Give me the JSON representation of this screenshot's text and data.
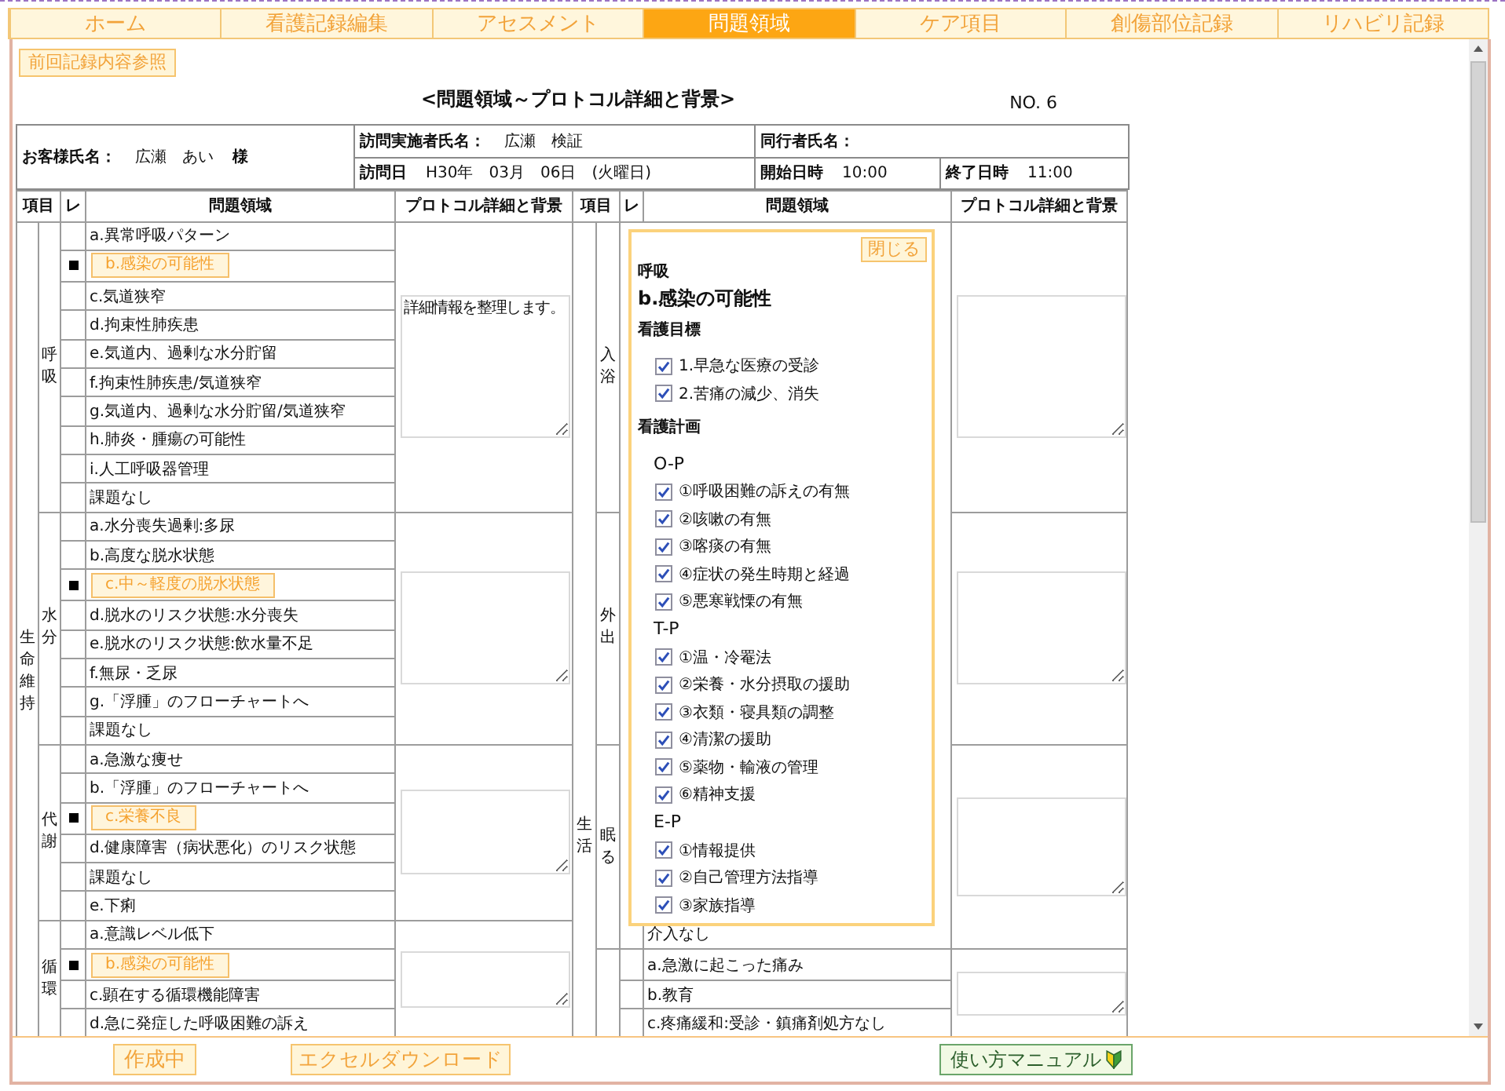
{
  "tabs": [
    {
      "label": "ホーム",
      "selected": false
    },
    {
      "label": "看護記録編集",
      "selected": false
    },
    {
      "label": "アセスメント",
      "selected": false
    },
    {
      "label": "問題領域",
      "selected": true
    },
    {
      "label": "ケア項目",
      "selected": false
    },
    {
      "label": "創傷部位記録",
      "selected": false
    },
    {
      "label": "リハビリ記録",
      "selected": false
    }
  ],
  "previous_record_button": "前回記録内容参照",
  "title": "<問題領域～プロトコル詳細と背景>",
  "record_number": "NO. 6",
  "visit_info": {
    "customer": {
      "label": "お客様氏名：",
      "value": "広瀬　あい",
      "suffix": "様"
    },
    "visitor": {
      "label": "訪問実施者氏名：",
      "value": "広瀬　検証"
    },
    "companion": {
      "label": "同行者氏名："
    },
    "visit_date": {
      "label": "訪問日",
      "value": "H30年　03月　06日　(火曜日)"
    },
    "start_time": {
      "label": "開始日時",
      "value": "10:00"
    },
    "end_time": {
      "label": "終了日時",
      "value": "11:00"
    }
  },
  "table": {
    "left": {
      "columns": [
        "項目",
        "レ",
        "問題領域",
        "プロトコル詳細と背景"
      ],
      "category": "生命維持",
      "groups": [
        {
          "label": "呼吸",
          "protocol": "詳細情報を整理します。",
          "rows": [
            {
              "text": "a.異常呼吸パターン",
              "checked": false
            },
            {
              "text": "b.感染の可能性",
              "checked": true
            },
            {
              "text": "c.気道狭窄",
              "checked": false
            },
            {
              "text": "d.拘束性肺疾患",
              "checked": false
            },
            {
              "text": "e.気道内、過剰な水分貯留",
              "checked": false
            },
            {
              "text": "f.拘束性肺疾患/気道狭窄",
              "checked": false
            },
            {
              "text": "g.気道内、過剰な水分貯留/気道狭窄",
              "checked": false
            },
            {
              "text": "h.肺炎・腫瘍の可能性",
              "checked": false
            },
            {
              "text": "i.人工呼吸器管理",
              "checked": false
            },
            {
              "text": "課題なし",
              "checked": false
            }
          ]
        },
        {
          "label": "水分",
          "rows": [
            {
              "text": "a.水分喪失過剰:多尿",
              "checked": false
            },
            {
              "text": "b.高度な脱水状態",
              "checked": false
            },
            {
              "text": "c.中～軽度の脱水状態",
              "checked": true
            },
            {
              "text": "d.脱水のリスク状態:水分喪失",
              "checked": false
            },
            {
              "text": "e.脱水のリスク状態:飲水量不足",
              "checked": false
            },
            {
              "text": "f.無尿・乏尿",
              "checked": false
            },
            {
              "text": "g.「浮腫」のフローチャートへ",
              "checked": false
            },
            {
              "text": "課題なし",
              "checked": false
            }
          ]
        },
        {
          "label": "代謝",
          "rows": [
            {
              "text": "a.急激な痩せ",
              "checked": false
            },
            {
              "text": "b.「浮腫」のフローチャートへ",
              "checked": false
            },
            {
              "text": "c.栄養不良",
              "checked": true
            },
            {
              "text": "d.健康障害（病状悪化）のリスク状態",
              "checked": false
            },
            {
              "text": "課題なし",
              "checked": false
            },
            {
              "text": "e.下痢",
              "checked": false
            }
          ]
        },
        {
          "label": "循環",
          "rows": [
            {
              "text": "a.意識レベル低下",
              "checked": false
            },
            {
              "text": "b.感染の可能性",
              "checked": true
            },
            {
              "text": "c.顕在する循環機能障害",
              "checked": false
            },
            {
              "text": "d.急に発症した呼吸困難の訴え",
              "checked": false
            }
          ]
        }
      ]
    },
    "right": {
      "columns": [
        "項目",
        "レ",
        "問題領域",
        "プロトコル詳細と背景"
      ],
      "category": "生活",
      "groups": [
        {
          "label": "入浴"
        },
        {
          "label": "外出"
        },
        {
          "label": "眠る",
          "rows": [
            {
              "text": "介入なし",
              "checked": false
            }
          ]
        },
        {
          "rows": [
            {
              "text": "a.急激に起こった痛み",
              "checked": false
            },
            {
              "text": "b.教育",
              "checked": false
            },
            {
              "text": "c.疼痛緩和:受診・鎮痛剤処方なし",
              "checked": false
            }
          ]
        }
      ]
    }
  },
  "popup": {
    "close_button": "閉じる",
    "category": "呼吸",
    "problem": "b.感染の可能性",
    "sections": [
      {
        "title": "看護目標",
        "groups": [
          {
            "items": [
              {
                "label": "1.早急な医療の受診",
                "checked": true
              },
              {
                "label": "2.苦痛の減少、消失",
                "checked": true
              }
            ]
          }
        ]
      },
      {
        "title": "看護計画",
        "groups": [
          {
            "label": "O-P",
            "items": [
              {
                "label": "①呼吸困難の訴えの有無",
                "checked": true
              },
              {
                "label": "②咳嗽の有無",
                "checked": true
              },
              {
                "label": "③喀痰の有無",
                "checked": true
              },
              {
                "label": "④症状の発生時期と経過",
                "checked": true
              },
              {
                "label": "⑤悪寒戦慄の有無",
                "checked": true
              }
            ]
          },
          {
            "label": "T-P",
            "items": [
              {
                "label": "①温・冷罨法",
                "checked": true
              },
              {
                "label": "②栄養・水分摂取の援助",
                "checked": true
              },
              {
                "label": "③衣類・寝具類の調整",
                "checked": true
              },
              {
                "label": "④清潔の援助",
                "checked": true
              },
              {
                "label": "⑤薬物・輸液の管理",
                "checked": true
              },
              {
                "label": "⑥精神支援",
                "checked": true
              }
            ]
          },
          {
            "label": "E-P",
            "items": [
              {
                "label": "①情報提供",
                "checked": true
              },
              {
                "label": "②自己管理方法指導",
                "checked": true
              },
              {
                "label": "③家族指導",
                "checked": true
              }
            ]
          }
        ]
      }
    ]
  },
  "footer": {
    "buttons": [
      {
        "label": "作成中",
        "kind": "status"
      },
      {
        "label": "エクセルダウンロード",
        "kind": "download"
      },
      {
        "label": "使い方マニュアル",
        "kind": "manual"
      }
    ]
  }
}
